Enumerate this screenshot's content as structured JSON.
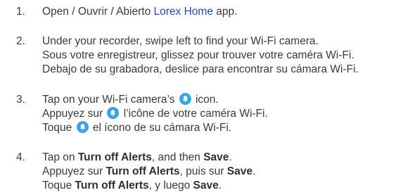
{
  "steps": [
    {
      "number": "1.",
      "lines": [
        {
          "before": "Open / Ouvrir / Abierto ",
          "brand": "Lorex Home",
          "after": " app."
        }
      ]
    },
    {
      "number": "2.",
      "lines": [
        {
          "text": "Under your recorder, swipe left to find your Wi-Fi camera."
        },
        {
          "text": "Sous votre enregistreur, glissez pour trouver votre caméra Wi-Fi."
        },
        {
          "text": "Debajo de su grabadora, deslice para encontrar su cámara Wi-Fi."
        }
      ]
    },
    {
      "number": "3.",
      "lines": [
        {
          "before": "Tap on your Wi-Fi camera’s ",
          "after": " icon."
        },
        {
          "before": "Appuyez sur ",
          "after": " l’icône de votre caméra Wi-Fi."
        },
        {
          "before": "Toque ",
          "after": " el ícono de su cámara Wi-Fi."
        }
      ],
      "icon": "bell-icon"
    },
    {
      "number": "4.",
      "lines": [
        {
          "before": "Tap on ",
          "bold1": "Turn off Alerts",
          "middle": ", and then ",
          "bold2": "Save",
          "after": "."
        },
        {
          "before": "Appuyez sur ",
          "bold1": "Turn off Alerts",
          "middle": ", puis sur ",
          "bold2": "Save",
          "after": "."
        },
        {
          "before": "Toque ",
          "bold1": "Turn off Alerts",
          "middle": ", y luego ",
          "bold2": "Save",
          "after": "."
        }
      ]
    }
  ],
  "colors": {
    "text": "#3a3a3a",
    "brand": "#1f4fa3",
    "icon_bg": "#3aa4e3"
  }
}
